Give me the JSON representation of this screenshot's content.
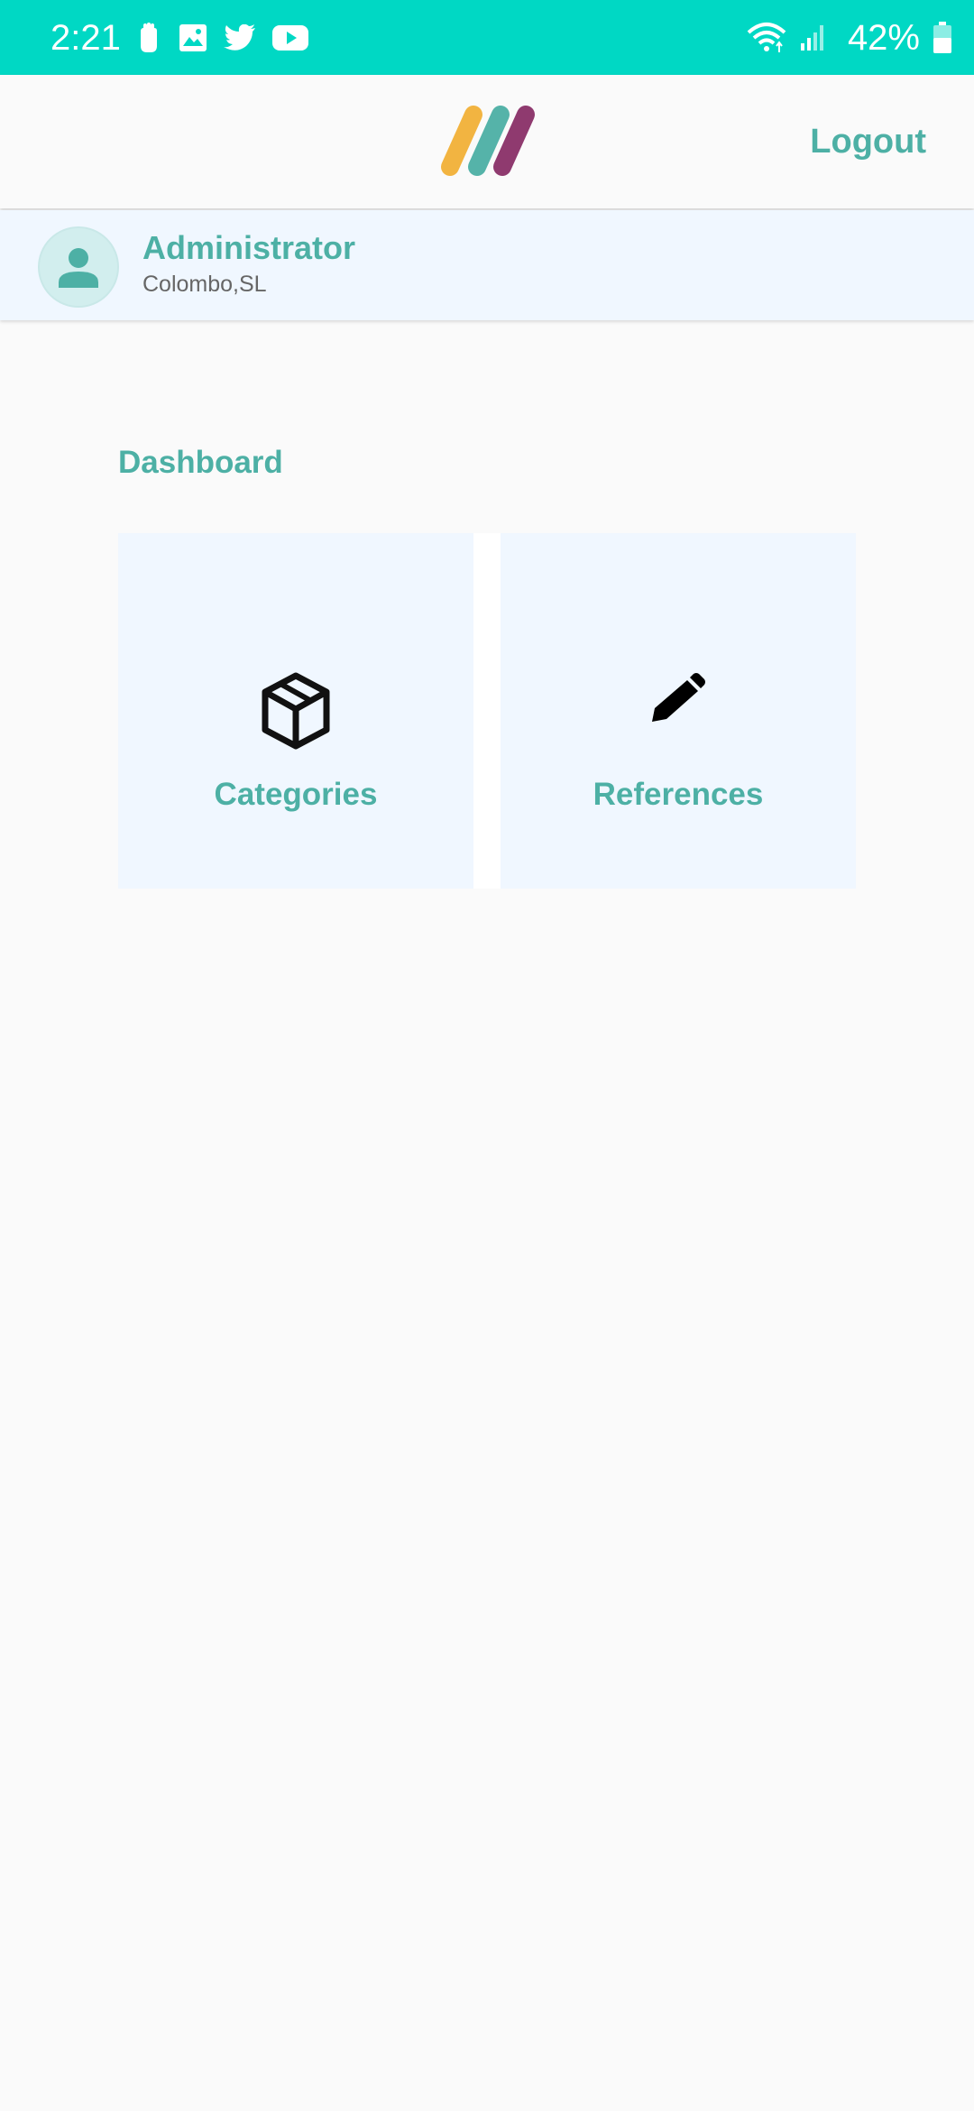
{
  "status_bar": {
    "time": "2:21",
    "battery_percent": "42%",
    "notification_icons": [
      "hand-icon",
      "image-icon",
      "twitter-icon",
      "youtube-icon"
    ],
    "system_icons": [
      "wifi-icon",
      "signal-icon",
      "battery-icon"
    ]
  },
  "app_bar": {
    "logo_colors": [
      "#f2b441",
      "#4db0a5",
      "#8a3068"
    ],
    "logout_label": "Logout"
  },
  "profile": {
    "name": "Administrator",
    "location": "Colombo,SL",
    "avatar_icon": "person-icon"
  },
  "dashboard": {
    "title": "Dashboard",
    "cards": [
      {
        "label": "Categories",
        "icon": "box-icon"
      },
      {
        "label": "References",
        "icon": "pencil-icon"
      }
    ]
  },
  "colors": {
    "status_bar": "#00d8c4",
    "accent": "#4db0a5",
    "card_bg": "#f0f7ff",
    "page_bg": "#fafafa"
  }
}
